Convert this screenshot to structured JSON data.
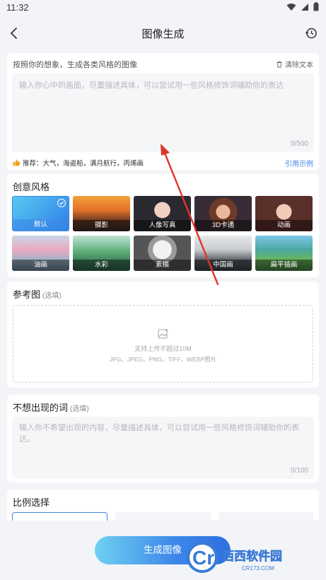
{
  "status": {
    "time": "11:32"
  },
  "nav": {
    "title": "图像生成"
  },
  "prompt": {
    "hint": "按照你的想象，生成各类风格的图像",
    "clear_label": "清除文本",
    "placeholder": "输入你心中的画面，尽量描述具体，可以尝试用一些风格修饰词辅助你的表达",
    "counter": "0/500",
    "recommend": "推荐：大气，海盗船，满月航行，丙烯画",
    "cite_label": "引用示例"
  },
  "styles": {
    "title": "创意风格",
    "items": [
      {
        "label": "默认"
      },
      {
        "label": "摄影"
      },
      {
        "label": "人像写真"
      },
      {
        "label": "3D卡通"
      },
      {
        "label": "动画"
      },
      {
        "label": "油画"
      },
      {
        "label": "水彩"
      },
      {
        "label": "素描"
      },
      {
        "label": "中国画"
      },
      {
        "label": "扁平插画"
      }
    ],
    "selected_index": 0
  },
  "reference": {
    "title": "参考图",
    "optional": "(选填)",
    "upload_line1": "支持上传不超过10M",
    "upload_line2": "JPG、JPEG、PNG、TIFF、WEBP图片"
  },
  "negative": {
    "title": "不想出现的词",
    "optional": "(选填)",
    "placeholder": "输入你不希望出现的内容，尽量描述具体，可以尝试用一些风格修饰词辅助你的表达。",
    "counter": "0/100"
  },
  "ratio": {
    "title": "比例选择"
  },
  "generate": {
    "label": "生成图像"
  },
  "watermark": {
    "brand": "西西软件园",
    "url": "CR173.COM"
  },
  "colors": {
    "accent": "#3b86e6",
    "background": "#f3f4f7",
    "arrow": "#e0352b"
  }
}
